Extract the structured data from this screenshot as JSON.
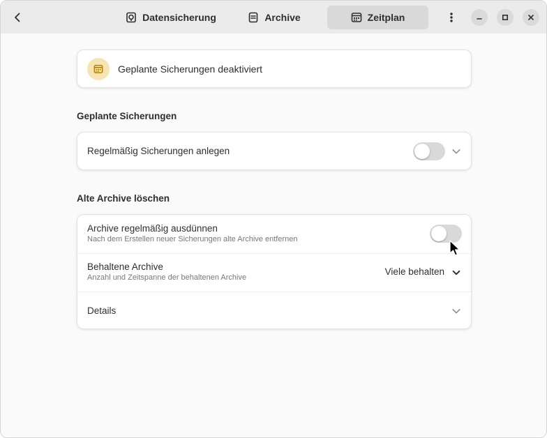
{
  "header": {
    "tabs": [
      {
        "label": "Datensicherung",
        "icon": "backup-icon",
        "active": false
      },
      {
        "label": "Archive",
        "icon": "archive-icon",
        "active": false
      },
      {
        "label": "Zeitplan",
        "icon": "calendar-icon",
        "active": true
      }
    ]
  },
  "status": {
    "text": "Geplante Sicherungen deaktiviert",
    "icon": "calendar-icon",
    "icon_color": "#b38600",
    "icon_bg": "#f7e4b3"
  },
  "scheduled": {
    "section_title": "Geplante Sicherungen",
    "row_label": "Regelmäßig Sicherungen anlegen",
    "enabled": false
  },
  "prune": {
    "section_title": "Alte Archive löschen",
    "rows": [
      {
        "title": "Archive regelmäßig ausdünnen",
        "subtitle": "Nach dem Erstellen neuer Sicherungen alte Archive entfernen",
        "enabled": false
      },
      {
        "title": "Behaltene Archive",
        "subtitle": "Anzahl und Zeitspanne der behaltenen Archive",
        "value": "Viele behalten"
      },
      {
        "title": "Details"
      }
    ]
  },
  "colors": {
    "window_bg": "#fafafa",
    "header_bg": "#ebebeb",
    "active_tab_bg": "#d9d9d9",
    "toggle_off": "#d9d9d9"
  }
}
